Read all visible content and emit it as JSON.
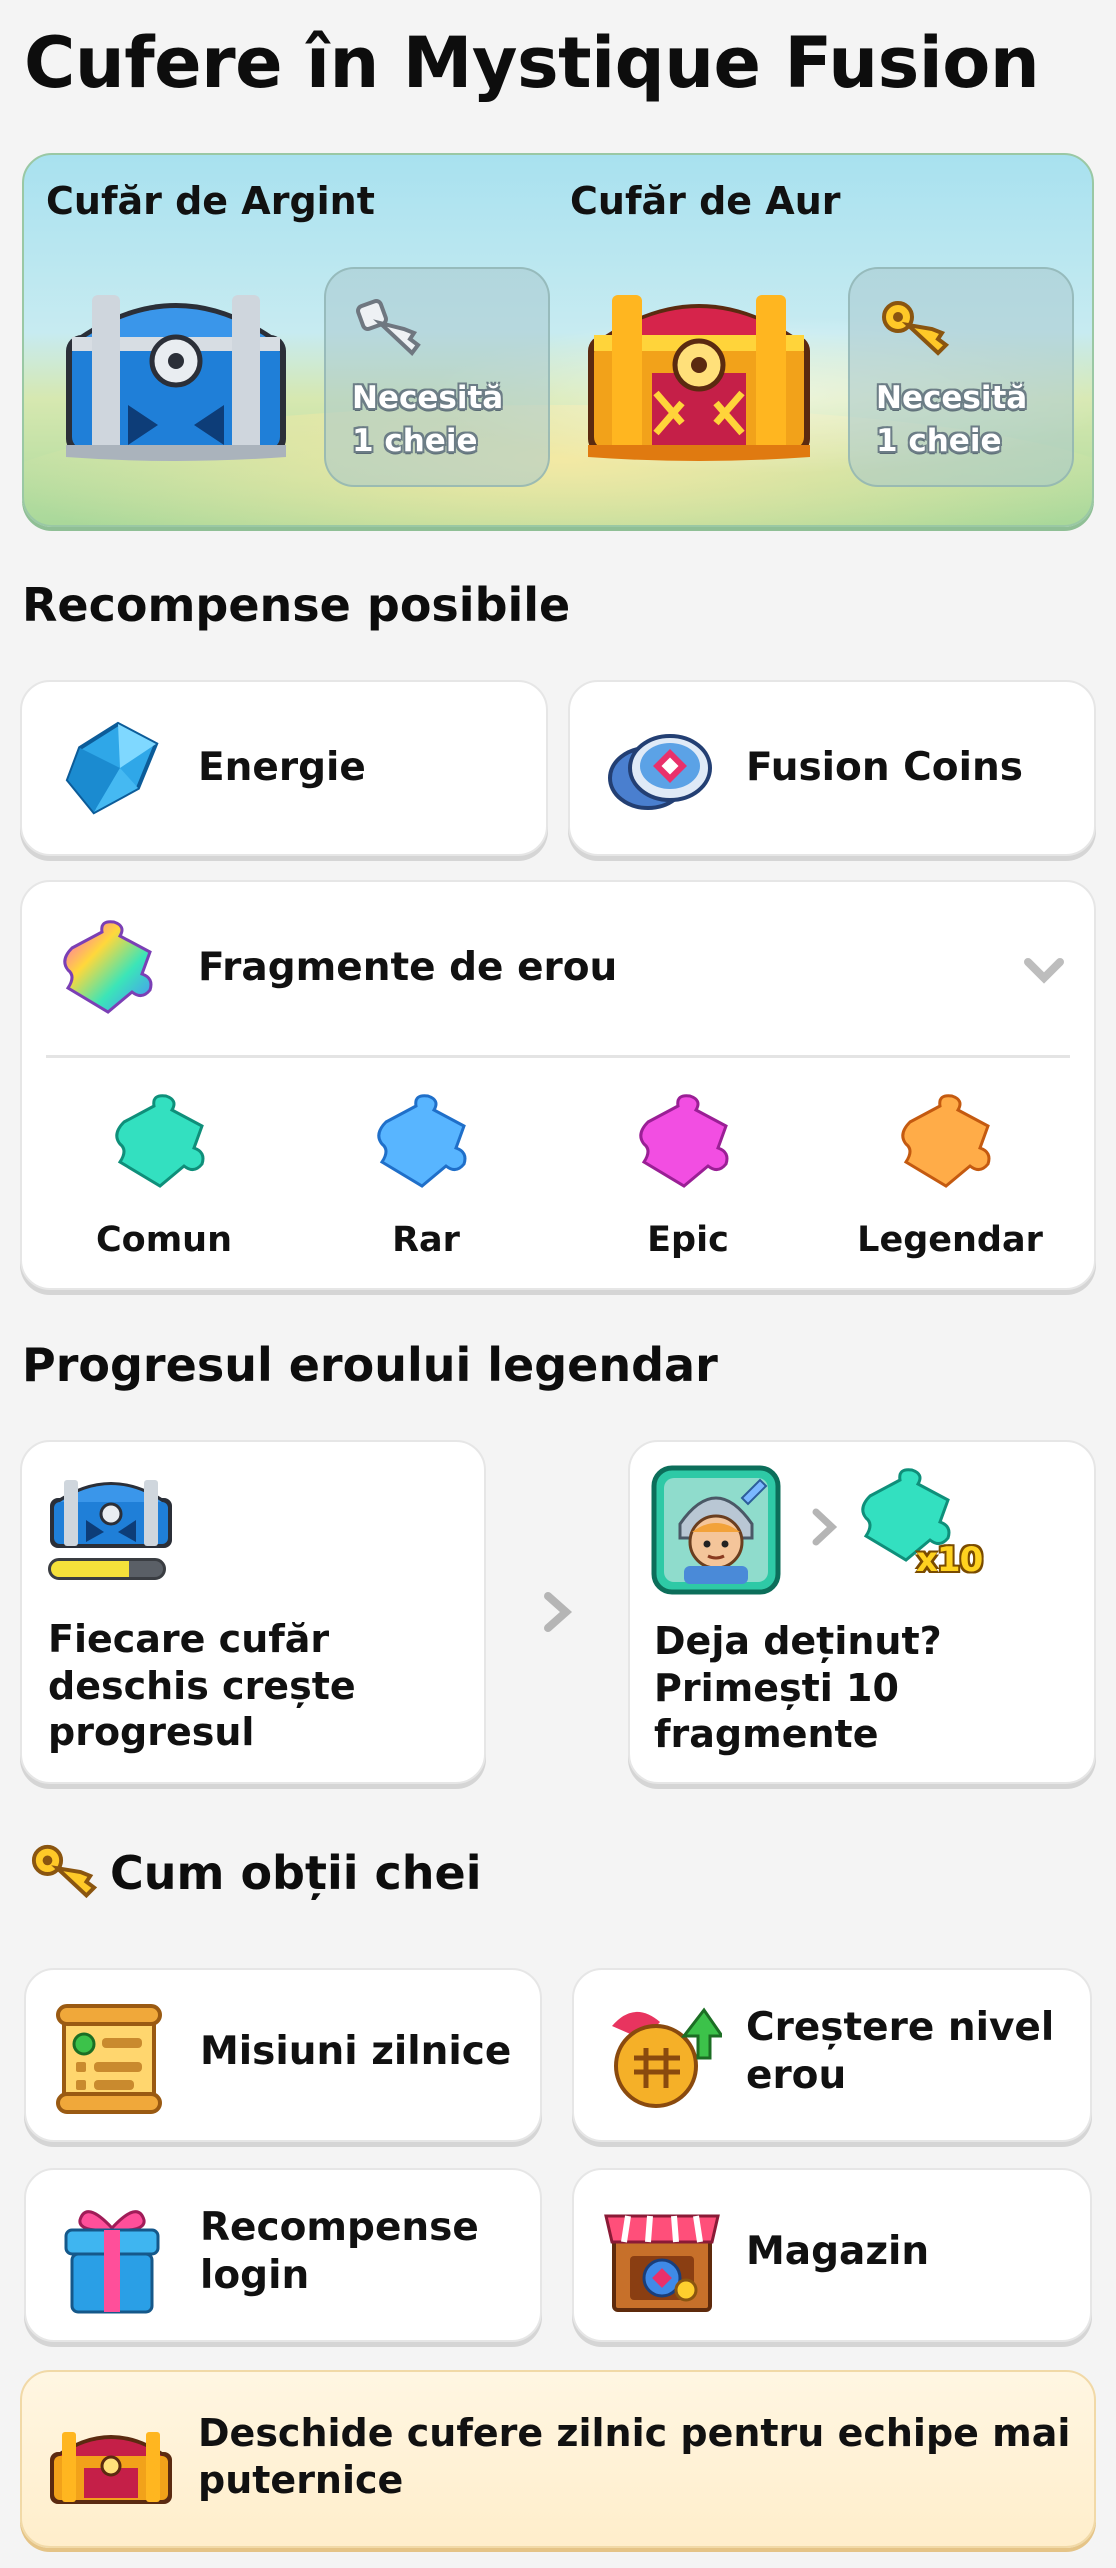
{
  "page_title": "Cufere în Mystique Fusion",
  "hero": {
    "silver_title": "Cufăr de Argint",
    "gold_title": "Cufăr de Aur",
    "silver_requirement": [
      "Necesită",
      "1 cheie"
    ],
    "gold_requirement": [
      "Necesită",
      "1 cheie"
    ]
  },
  "rewards": {
    "heading": "Recompense posibile",
    "energy_label": "Energie",
    "coins_label": "Fusion Coins",
    "shards_label": "Fragmente de erou",
    "tiers": [
      "Comun",
      "Rar",
      "Epic",
      "Legendar"
    ]
  },
  "progress": {
    "heading": "Progresul eroului legendar",
    "left_text": "Fiecare cufăr deschis crește progresul",
    "right_text": [
      "Deja deținut?",
      "Primești 10",
      "fragmente"
    ],
    "badge": "x10",
    "progress_fill": 0.7
  },
  "keys": {
    "heading": "Cum obții chei",
    "daily": "Misiuni zilnice",
    "levelup": [
      "Creștere nivel",
      "erou"
    ],
    "login": [
      "Recompense",
      "login"
    ],
    "shop": "Magazin"
  },
  "banner": {
    "text": [
      "Deschide cufere zilnic pentru echipe mai",
      "puternice"
    ]
  },
  "colors": {
    "background": "#f4f4f4",
    "card": "#ffffff",
    "banner": "#fff1d3",
    "progress": "#f5e13a"
  }
}
